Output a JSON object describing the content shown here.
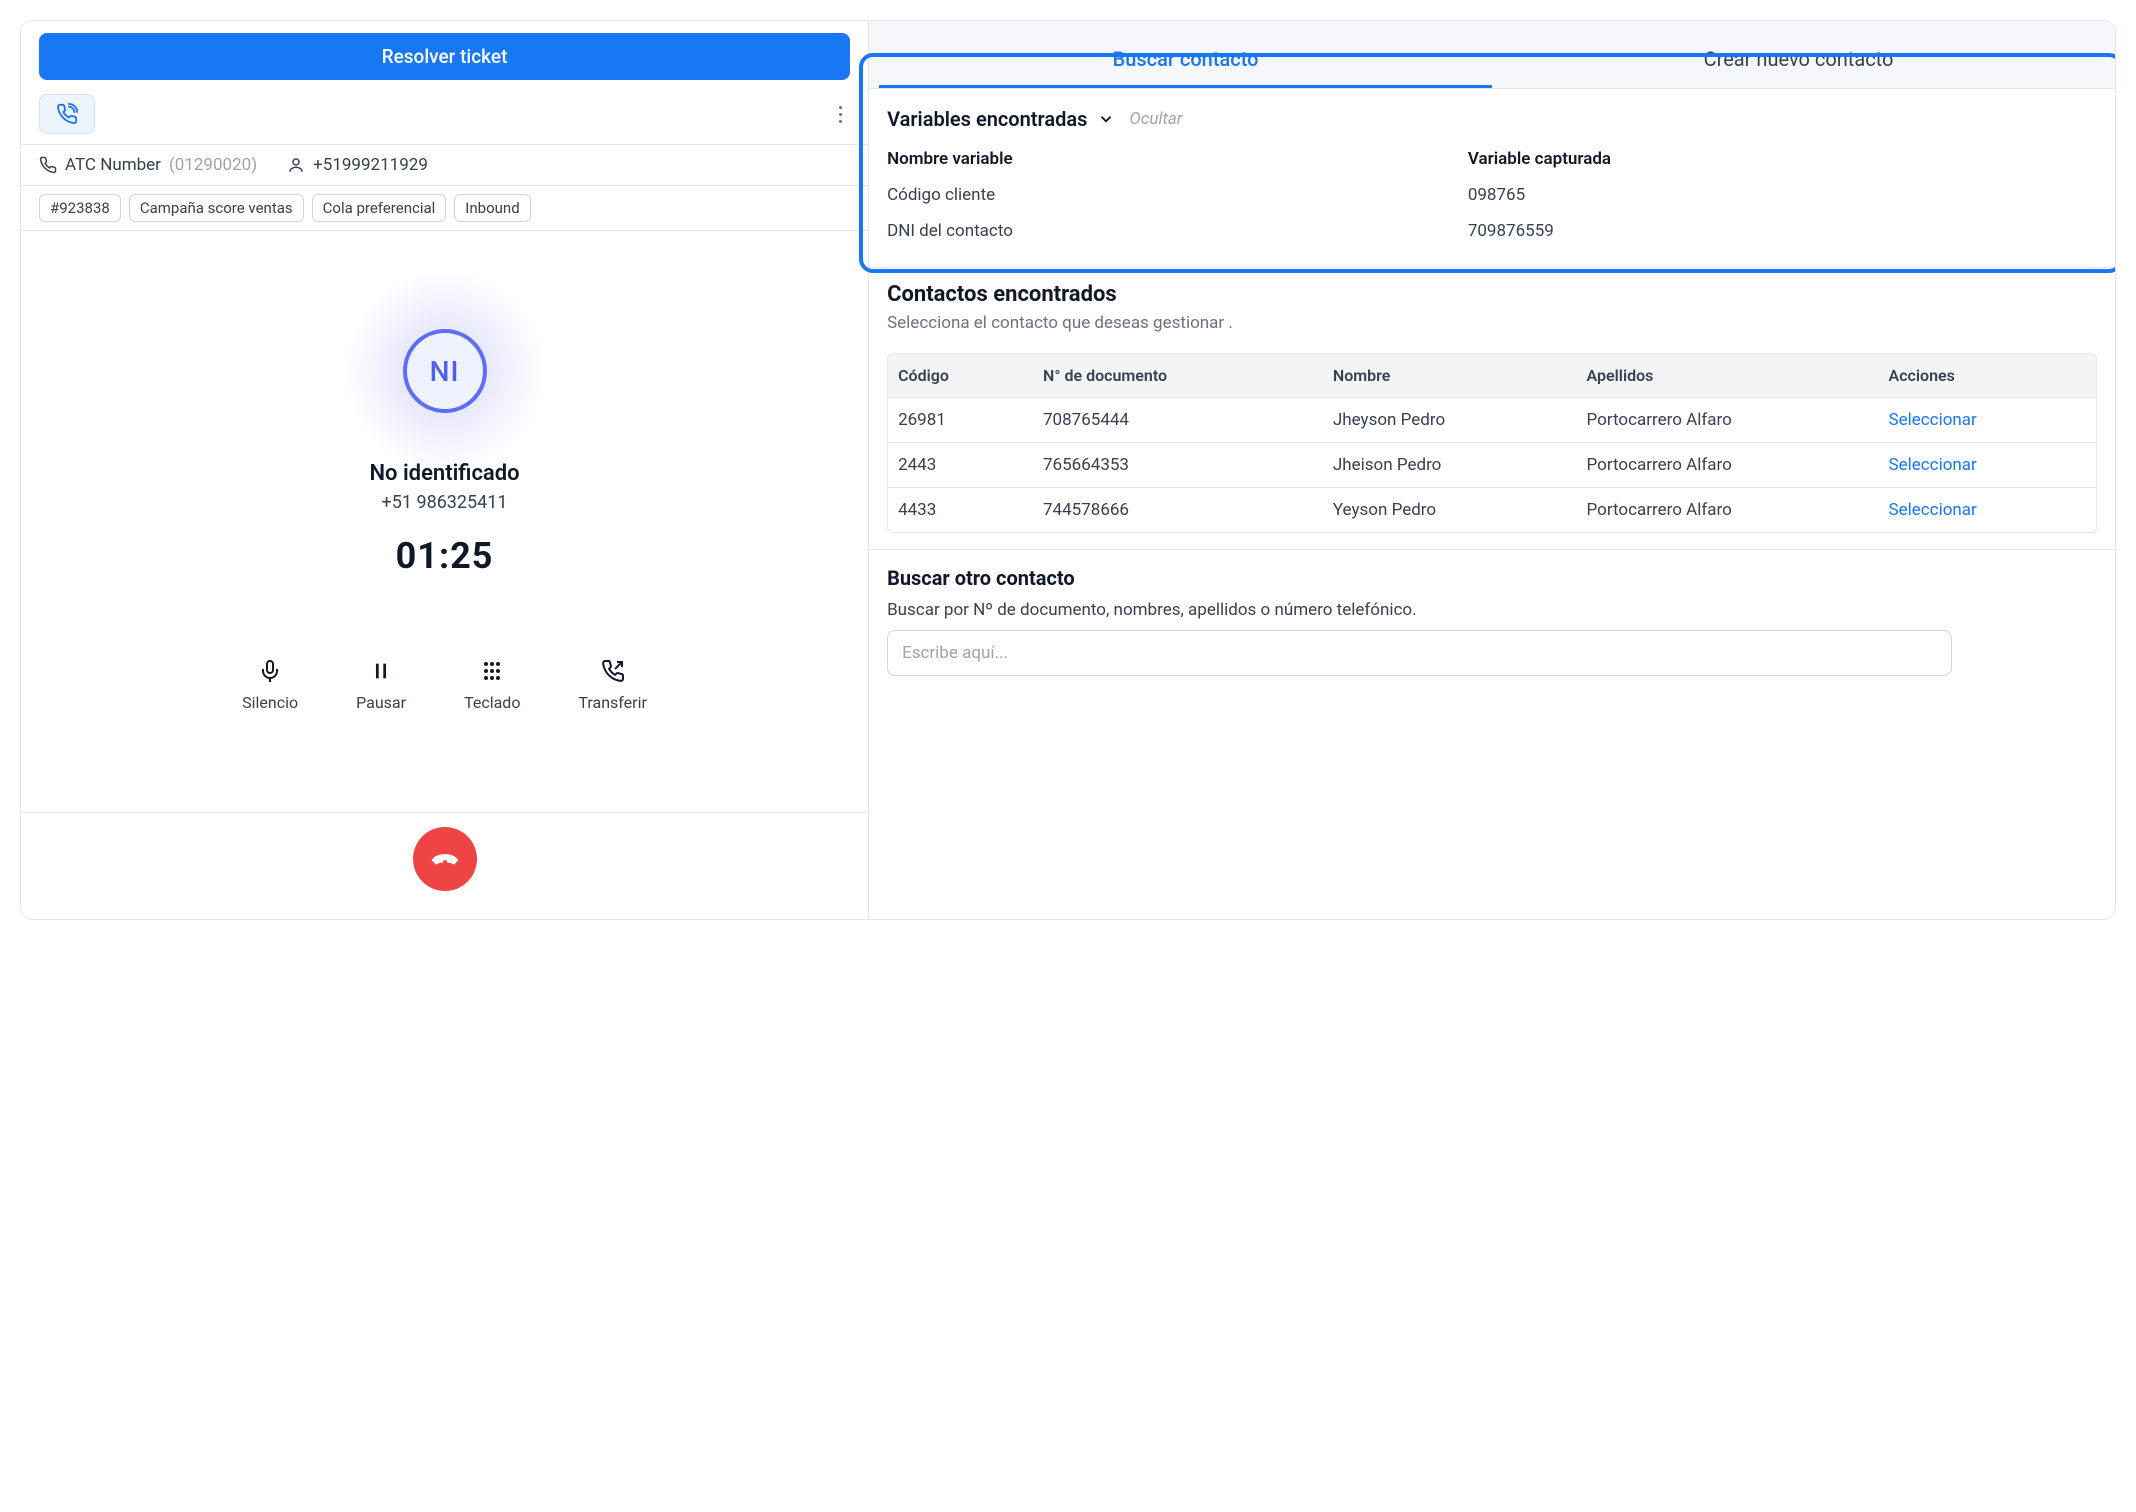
{
  "left": {
    "resolve_label": "Resolver ticket",
    "atc_label": "ATC Number",
    "atc_number": "(01290020)",
    "call_number": "+51999211929",
    "tags": [
      "#923838",
      "Campaña score ventas",
      "Cola preferencial",
      "Inbound"
    ],
    "avatar_initials": "NI",
    "caller_name": "No identificado",
    "caller_number": "+51 986325411",
    "timer": "01:25",
    "controls": {
      "silence": "Silencio",
      "pause": "Pausar",
      "keypad": "Teclado",
      "transfer": "Transferir"
    }
  },
  "right": {
    "tabs": {
      "search": "Buscar contacto",
      "create": "Crear nuevo contacto"
    },
    "vars": {
      "title": "Variables encontradas",
      "hide": "Ocultar",
      "col_name": "Nombre variable",
      "col_value": "Variable capturada",
      "rows": [
        {
          "name": "Código cliente",
          "value": "098765"
        },
        {
          "name": "DNI del contacto",
          "value": "709876559"
        }
      ]
    },
    "contacts": {
      "title": "Contactos encontrados",
      "subtitle": "Selecciona el contacto que deseas gestionar .",
      "columns": {
        "code": "Código",
        "doc": "N° de documento",
        "name": "Nombre",
        "last": "Apellidos",
        "actions": "Acciones"
      },
      "action_label": "Seleccionar",
      "rows": [
        {
          "code": "26981",
          "doc": "708765444",
          "name": "Jheyson Pedro",
          "last": "Portocarrero Alfaro"
        },
        {
          "code": "2443",
          "doc": "765664353",
          "name": "Jheison Pedro",
          "last": "Portocarrero Alfaro"
        },
        {
          "code": "4433",
          "doc": "744578666",
          "name": "Yeyson Pedro",
          "last": "Portocarrero Alfaro"
        }
      ]
    },
    "search_other": {
      "title": "Buscar otro contacto",
      "subtitle": "Buscar por  Nº de documento, nombres, apellidos o número telefónico.",
      "placeholder": "Escribe aquí..."
    }
  }
}
